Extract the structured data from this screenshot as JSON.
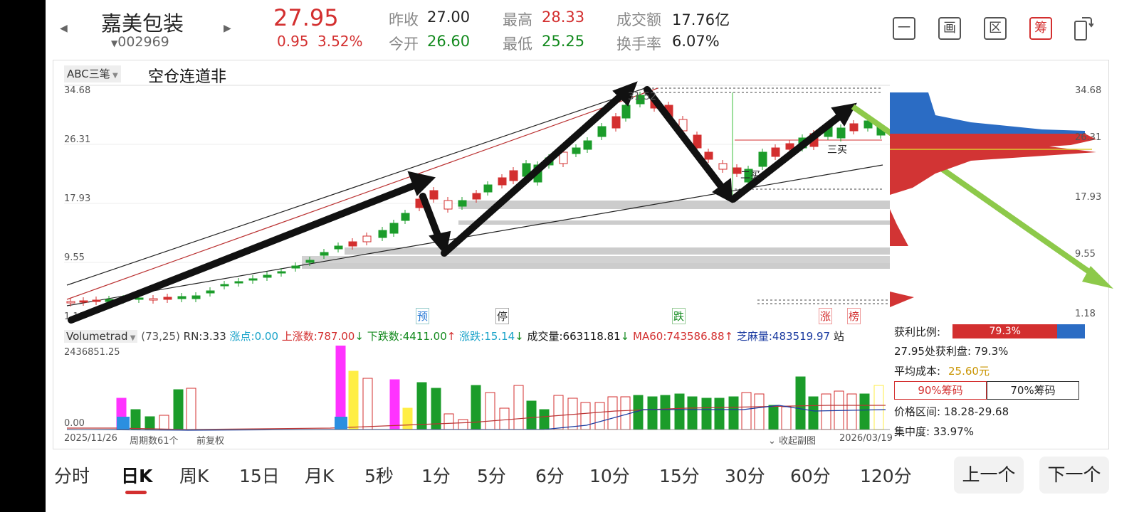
{
  "header": {
    "stock_name": "嘉美包装",
    "stock_code": "002969",
    "price": "27.95",
    "change": "0.95",
    "change_pct": "3.52%",
    "prev_close_label": "昨收",
    "prev_close": "27.00",
    "open_label": "今开",
    "open": "26.60",
    "high_label": "最高",
    "high": "28.33",
    "low_label": "最低",
    "low": "25.25",
    "turnover_label": "成交额",
    "turnover": "17.76亿",
    "turnover_rate_label": "换手率",
    "turnover_rate": "6.07%"
  },
  "toolbar": {
    "btn1": "一",
    "btn2": "画",
    "btn3": "区",
    "btn4": "筹"
  },
  "kline": {
    "indicator": "ABC三笔",
    "note": "空仓连道非",
    "price_labels": [
      "34.68",
      "26.31",
      "17.93",
      "9.55",
      "1.18"
    ],
    "right_labels": [
      "34.68",
      "26.31",
      "17.93",
      "9.55",
      "1.18"
    ],
    "peak_label": "31.52",
    "tags": {
      "yu": "预",
      "ting": "停",
      "die": "跌",
      "zhang": "涨",
      "bang": "榜"
    },
    "annot_1": "二买",
    "annot_2": "三买"
  },
  "volume": {
    "indicator": "Volumetrad",
    "params": "(73,25)",
    "rn": "RN:3.33",
    "zhang_dian": "涨点:0.00",
    "up_count": "上涨数:787.00",
    "down_count": "下跌数:4411.00",
    "zhang_die": "涨跌:15.14",
    "vol": "成交量:663118.81",
    "ma60": "MA60:743586.88",
    "zhima": "芝麻量:483519.97",
    "zhan": "站",
    "max_label": "2436851.25",
    "zero_label": "0.00",
    "start_date": "2025/11/26",
    "period_count": "周期数61个",
    "adjust": "前复权",
    "collapse": "收起副图",
    "end_date": "2026/03/19"
  },
  "chips": {
    "profit_ratio_label": "获利比例:",
    "profit_ratio": "79.3%",
    "profit_at_price": "27.95处获利盘: 79.3%",
    "avg_cost_label": "平均成本:",
    "avg_cost": "25.60元",
    "chip90": "90%筹码",
    "chip70": "70%筹码",
    "price_range": "价格区间: 18.28-29.68",
    "concentration": "集中度: 33.97%"
  },
  "tabs": [
    "分时",
    "日K",
    "周K",
    "15日",
    "月K",
    "5秒",
    "1分",
    "5分",
    "6分",
    "10分",
    "15分",
    "30分",
    "60分",
    "120分"
  ],
  "nav": {
    "prev": "上一个",
    "next": "下一个"
  }
}
